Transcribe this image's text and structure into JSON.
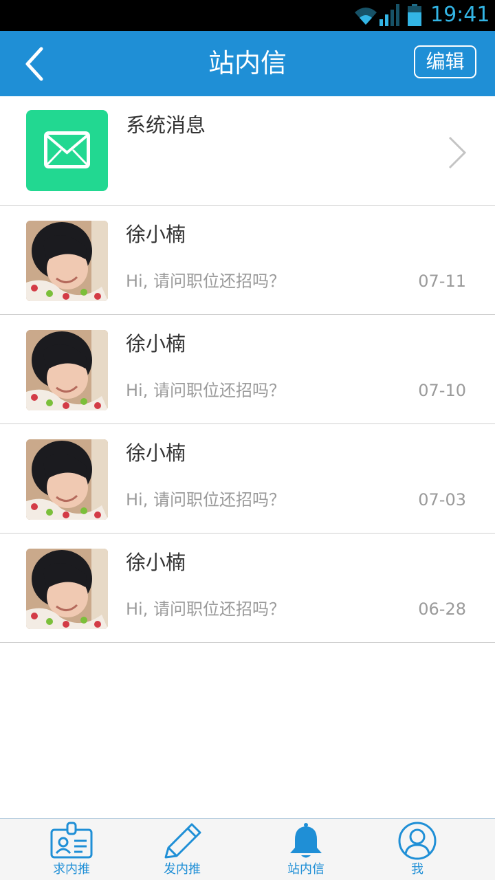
{
  "status_bar": {
    "time": "19:41",
    "icons": [
      "wifi-icon",
      "signal-icon",
      "battery-icon"
    ]
  },
  "header": {
    "title": "站内信",
    "edit_label": "编辑",
    "back_icon": "back-arrow-icon"
  },
  "system_message": {
    "label": "系统消息",
    "icon": "envelope-icon"
  },
  "messages": [
    {
      "sender": "徐小楠",
      "preview": "Hi, 请问职位还招吗？",
      "date": "07-11"
    },
    {
      "sender": "徐小楠",
      "preview": "Hi, 请问职位还招吗？",
      "date": "07-10"
    },
    {
      "sender": "徐小楠",
      "preview": "Hi, 请问职位还招吗？",
      "date": "07-03"
    },
    {
      "sender": "徐小楠",
      "preview": "Hi, 请问职位还招吗？",
      "date": "06-28"
    }
  ],
  "tab_bar": {
    "tabs": [
      {
        "label": "求内推",
        "icon": "id-card-icon"
      },
      {
        "label": "发内推",
        "icon": "pencil-icon"
      },
      {
        "label": "站内信",
        "icon": "bell-icon",
        "active": true
      },
      {
        "label": "我",
        "icon": "user-icon"
      }
    ]
  },
  "colors": {
    "primary": "#1f8fd6",
    "system_icon_bg": "#22d891",
    "status_clock": "#33b5e5"
  }
}
